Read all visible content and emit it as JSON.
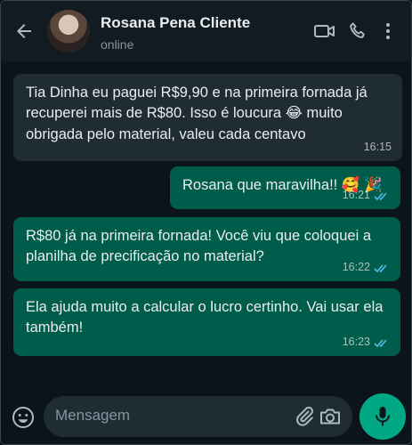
{
  "header": {
    "contact_name": "Rosana Pena Cliente",
    "status": "online"
  },
  "messages": [
    {
      "direction": "incoming",
      "text": "Tia Dinha eu paguei R$9,90 e na primeira fornada já recuperei mais de R$80. Isso é loucura 😂 muito obrigada pelo material, valeu cada centavo",
      "time": "16:15"
    },
    {
      "direction": "outgoing",
      "text": "Rosana que maravilha!! 🥰 🎉",
      "time": "16:21",
      "read": true
    },
    {
      "direction": "outgoing",
      "text": "R$80 já na primeira fornada! Você viu que coloquei a planilha de precificação no material?",
      "time": "16:22",
      "read": true
    },
    {
      "direction": "outgoing",
      "text": " Ela ajuda muito a calcular o lucro certinho. Vai usar ela também!",
      "time": "16:23",
      "read": true
    }
  ],
  "composer": {
    "placeholder": "Mensagem"
  },
  "icons": {
    "back": "arrow-left-icon",
    "video": "video-call-icon",
    "phone": "phone-icon",
    "menu": "more-vert-icon",
    "emoji": "emoji-icon",
    "attach": "paperclip-icon",
    "camera": "camera-icon",
    "mic": "microphone-icon"
  },
  "colors": {
    "background": "#0b141a",
    "header": "#111b21",
    "incoming_bubble": "#202c33",
    "outgoing_bubble": "#005c4b",
    "read_ticks": "#53bdeb",
    "accent": "#00a884"
  }
}
